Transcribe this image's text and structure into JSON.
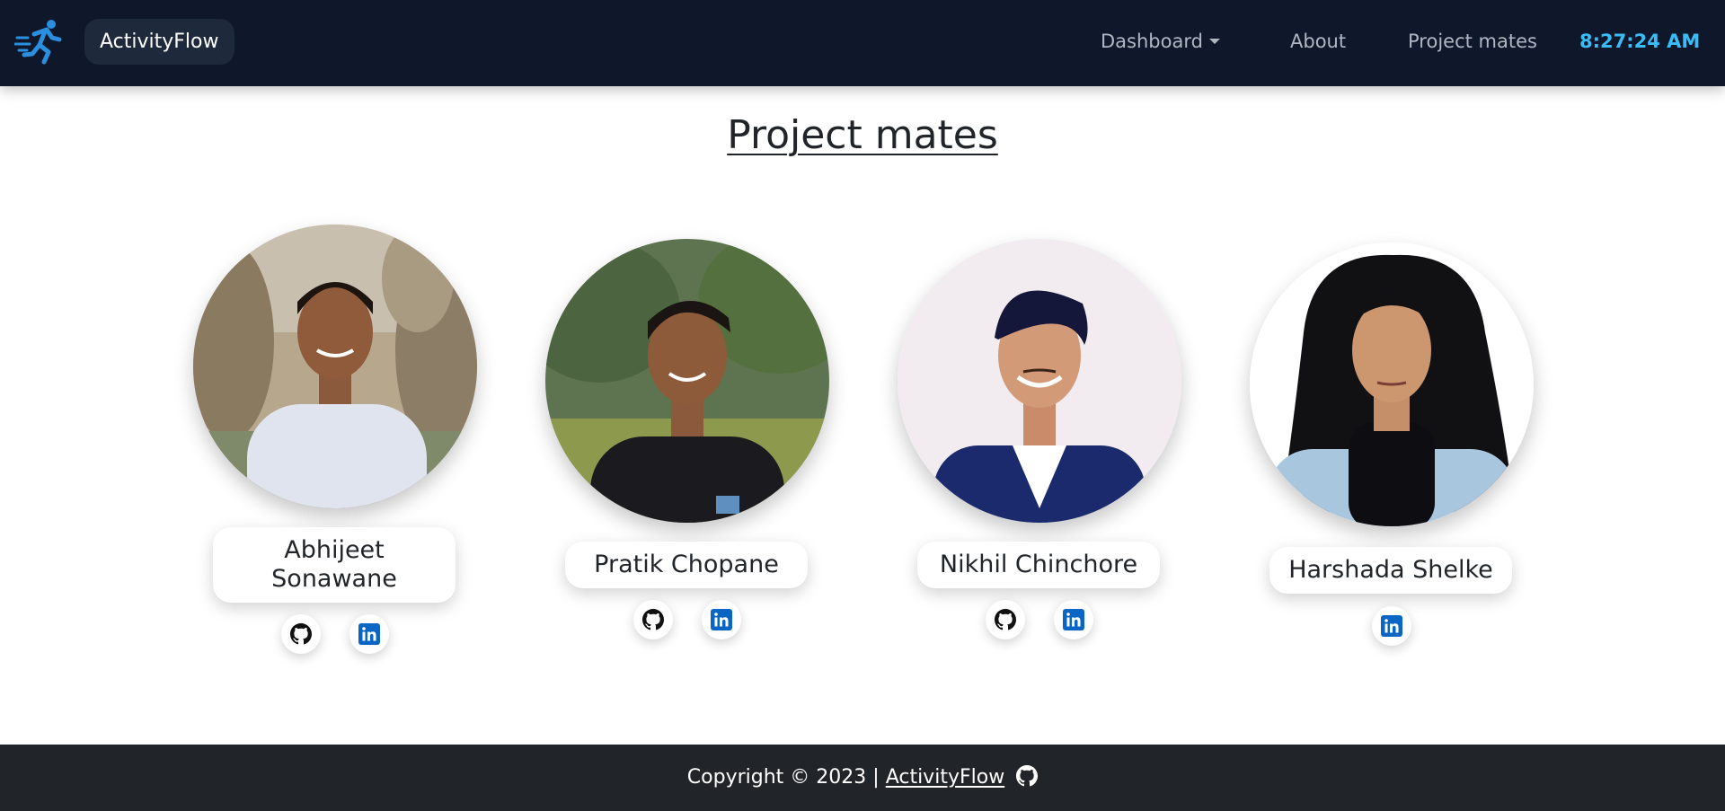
{
  "header": {
    "brand": "ActivityFlow",
    "nav": {
      "dashboard": "Dashboard",
      "about": "About",
      "project_mates": "Project mates"
    },
    "clock": "8:27:24 AM",
    "accent_color": "#38bdf8"
  },
  "main": {
    "title": "Project mates",
    "mates": [
      {
        "name": "Abhijeet Sonawane",
        "links": [
          "github-icon",
          "linkedin-icon"
        ]
      },
      {
        "name": "Pratik Chopane",
        "links": [
          "github-icon",
          "linkedin-icon"
        ]
      },
      {
        "name": "Nikhil Chinchore",
        "links": [
          "github-icon",
          "linkedin-icon"
        ]
      },
      {
        "name": "Harshada Shelke",
        "links": [
          "linkedin-icon"
        ]
      }
    ]
  },
  "footer": {
    "prefix": "Copyright © 2023 |",
    "link": "ActivityFlow"
  }
}
